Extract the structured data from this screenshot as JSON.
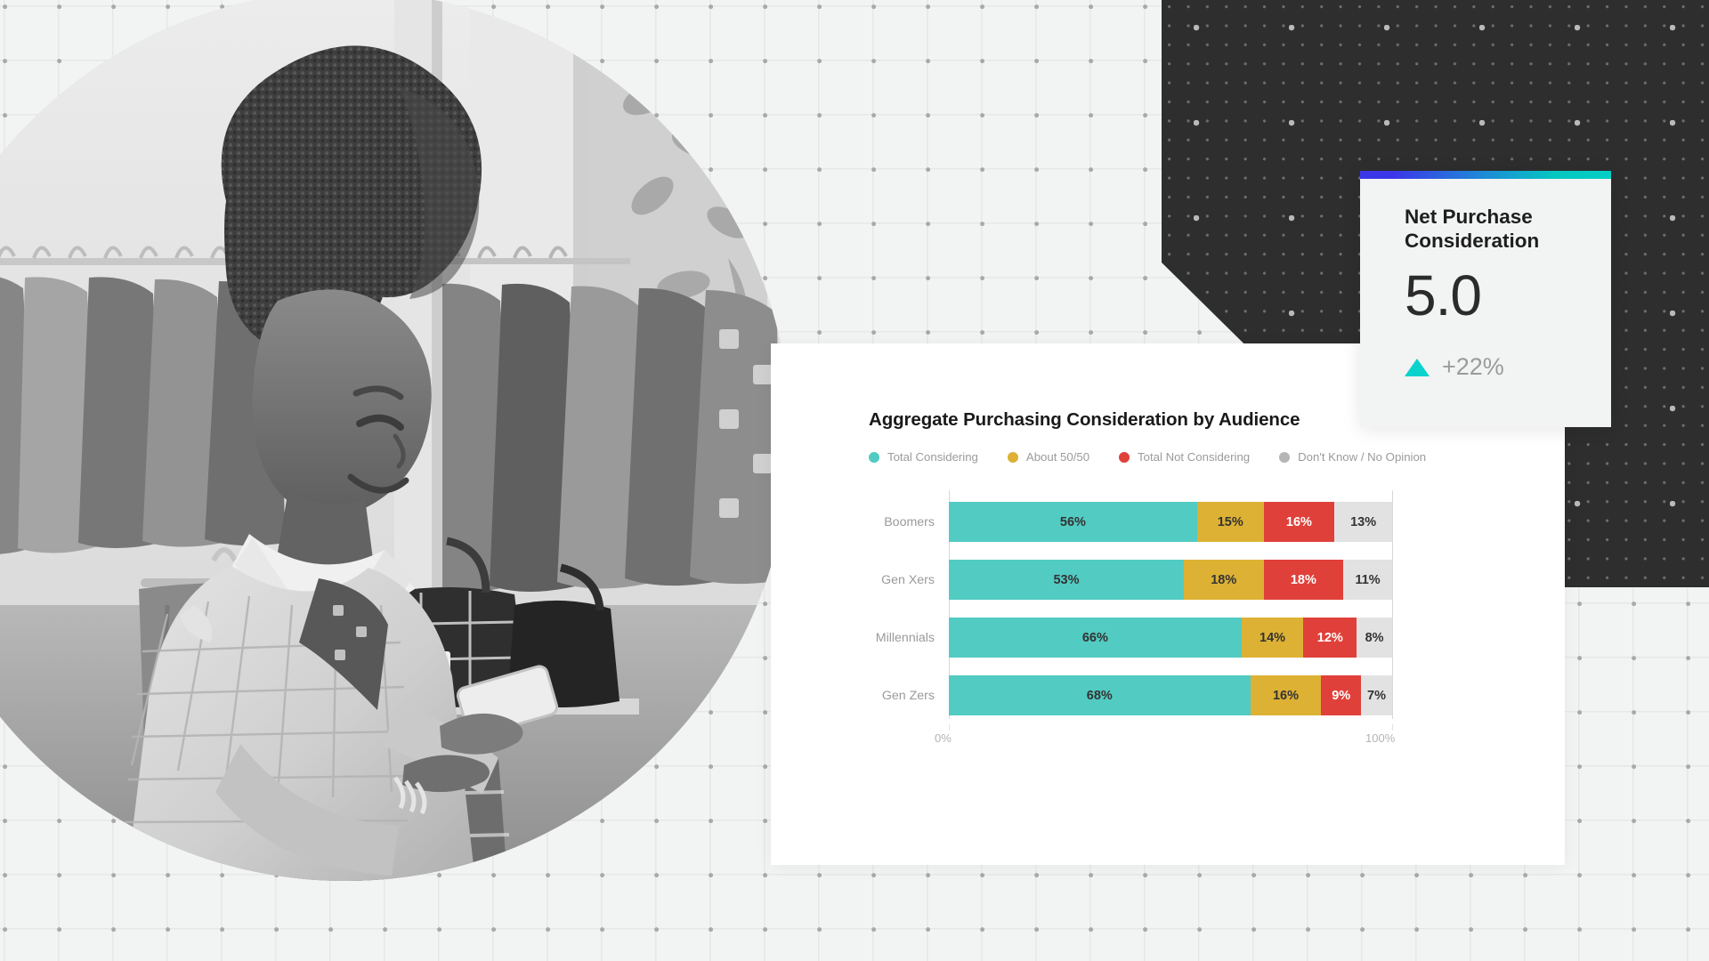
{
  "background": {
    "grid_color": "#e6e7e7",
    "grid_dot_color": "#a9a9a9",
    "page_bg": "#f2f3f3",
    "dark_panel_bg": "#2e2e2e",
    "dark_panel_dot_color": "#b9b9b9"
  },
  "photo": {
    "alt": "Woman shopping in a clothing store looking at her smartphone",
    "treatment": "grayscale-circle"
  },
  "kpi": {
    "title": "Net Purchase Consideration",
    "value": "5.0",
    "delta": "+22%",
    "trend_icon": "triangle-up-icon",
    "trend_color": "#0ad2cc",
    "accent_gradient_start": "#3b37e8",
    "accent_gradient_end": "#03cfc6"
  },
  "chart_data": {
    "type": "bar",
    "orientation": "horizontal",
    "stacked": true,
    "normalized": true,
    "title": "Aggregate Purchasing Consideration by Audience",
    "xlabel": "",
    "ylabel": "",
    "xlim": [
      0,
      100
    ],
    "xtick_labels": [
      "0%",
      "100%"
    ],
    "grid": false,
    "legend_position": "top",
    "categories": [
      "Boomers",
      "Gen Xers",
      "Millennials",
      "Gen Zers"
    ],
    "series": [
      {
        "name": "Total Considering",
        "color": "#52cbc2",
        "values": [
          56,
          53,
          66,
          68
        ],
        "labels": [
          "56%",
          "53%",
          "66%",
          "68%"
        ]
      },
      {
        "name": "About 50/50",
        "color": "#ddb134",
        "values": [
          15,
          18,
          14,
          16
        ],
        "labels": [
          "15%",
          "18%",
          "14%",
          "16%"
        ]
      },
      {
        "name": "Total Not Considering",
        "color": "#e0403a",
        "values": [
          16,
          18,
          12,
          9
        ],
        "labels": [
          "16%",
          "18%",
          "12%",
          "9%"
        ]
      },
      {
        "name": "Don't Know / No Opinion",
        "color": "#e2e2e2",
        "values": [
          13,
          11,
          8,
          7
        ],
        "labels": [
          "13%",
          "11%",
          "8%",
          "7%"
        ]
      }
    ]
  }
}
